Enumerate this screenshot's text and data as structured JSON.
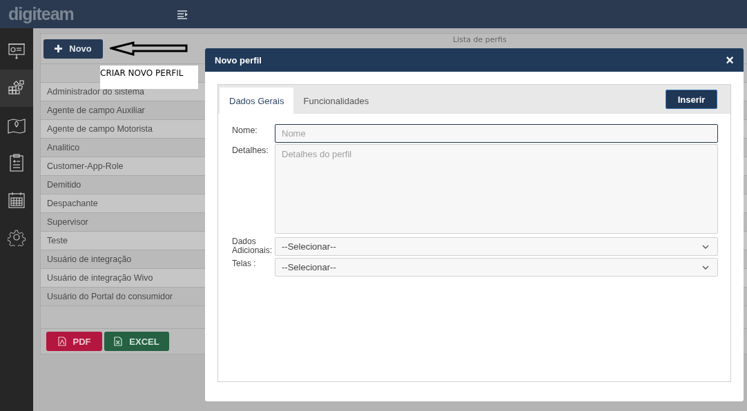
{
  "header": {
    "logo": "digiteam",
    "menu_toggle": true
  },
  "sidebar": {
    "items": [
      {
        "kind": "presentation",
        "selected": false
      },
      {
        "kind": "blocks",
        "selected": true
      },
      {
        "kind": "map",
        "selected": false
      },
      {
        "kind": "clipboard",
        "selected": false
      },
      {
        "kind": "calendar",
        "selected": false
      },
      {
        "kind": "settings",
        "selected": false
      }
    ]
  },
  "toolbar": {
    "new_button": "Novo",
    "list_title": "Lista de perfis"
  },
  "annotation": {
    "label": "CRIAR NOVO PERFIL"
  },
  "profiles": [
    "Administrador do sistema",
    "Agente de campo Auxiliar",
    "Agente de campo Motorista",
    "Analitico",
    "Customer-App-Role",
    "Demitido",
    "Despachante",
    "Supervisor",
    "Teste",
    "Usuário de integração",
    "Usuário de integração Wivo",
    "Usuário do Portal do consumidor"
  ],
  "export_buttons": [
    {
      "kind": "pdf",
      "label": "PDF"
    },
    {
      "kind": "excel",
      "label": "EXCEL"
    }
  ],
  "modal": {
    "title": "Novo perfil",
    "close": "×",
    "tabs": [
      {
        "label": "Dados Gerais",
        "selected": true
      },
      {
        "label": "Funcionalidades",
        "selected": false
      }
    ],
    "insert_button": "Inserir",
    "fields": [
      {
        "kind": "input",
        "label": "Nome:",
        "placeholder": "Nome",
        "focused": true
      },
      {
        "kind": "textarea",
        "label": "Detalhes:",
        "placeholder": "Detalhes do perfil",
        "focused": false
      },
      {
        "kind": "select",
        "label": "Dados Adicionais:",
        "value": "--Selecionar--",
        "focused": false
      },
      {
        "kind": "select",
        "label": "Telas :",
        "value": "--Selecionar--",
        "focused": false
      }
    ]
  }
}
